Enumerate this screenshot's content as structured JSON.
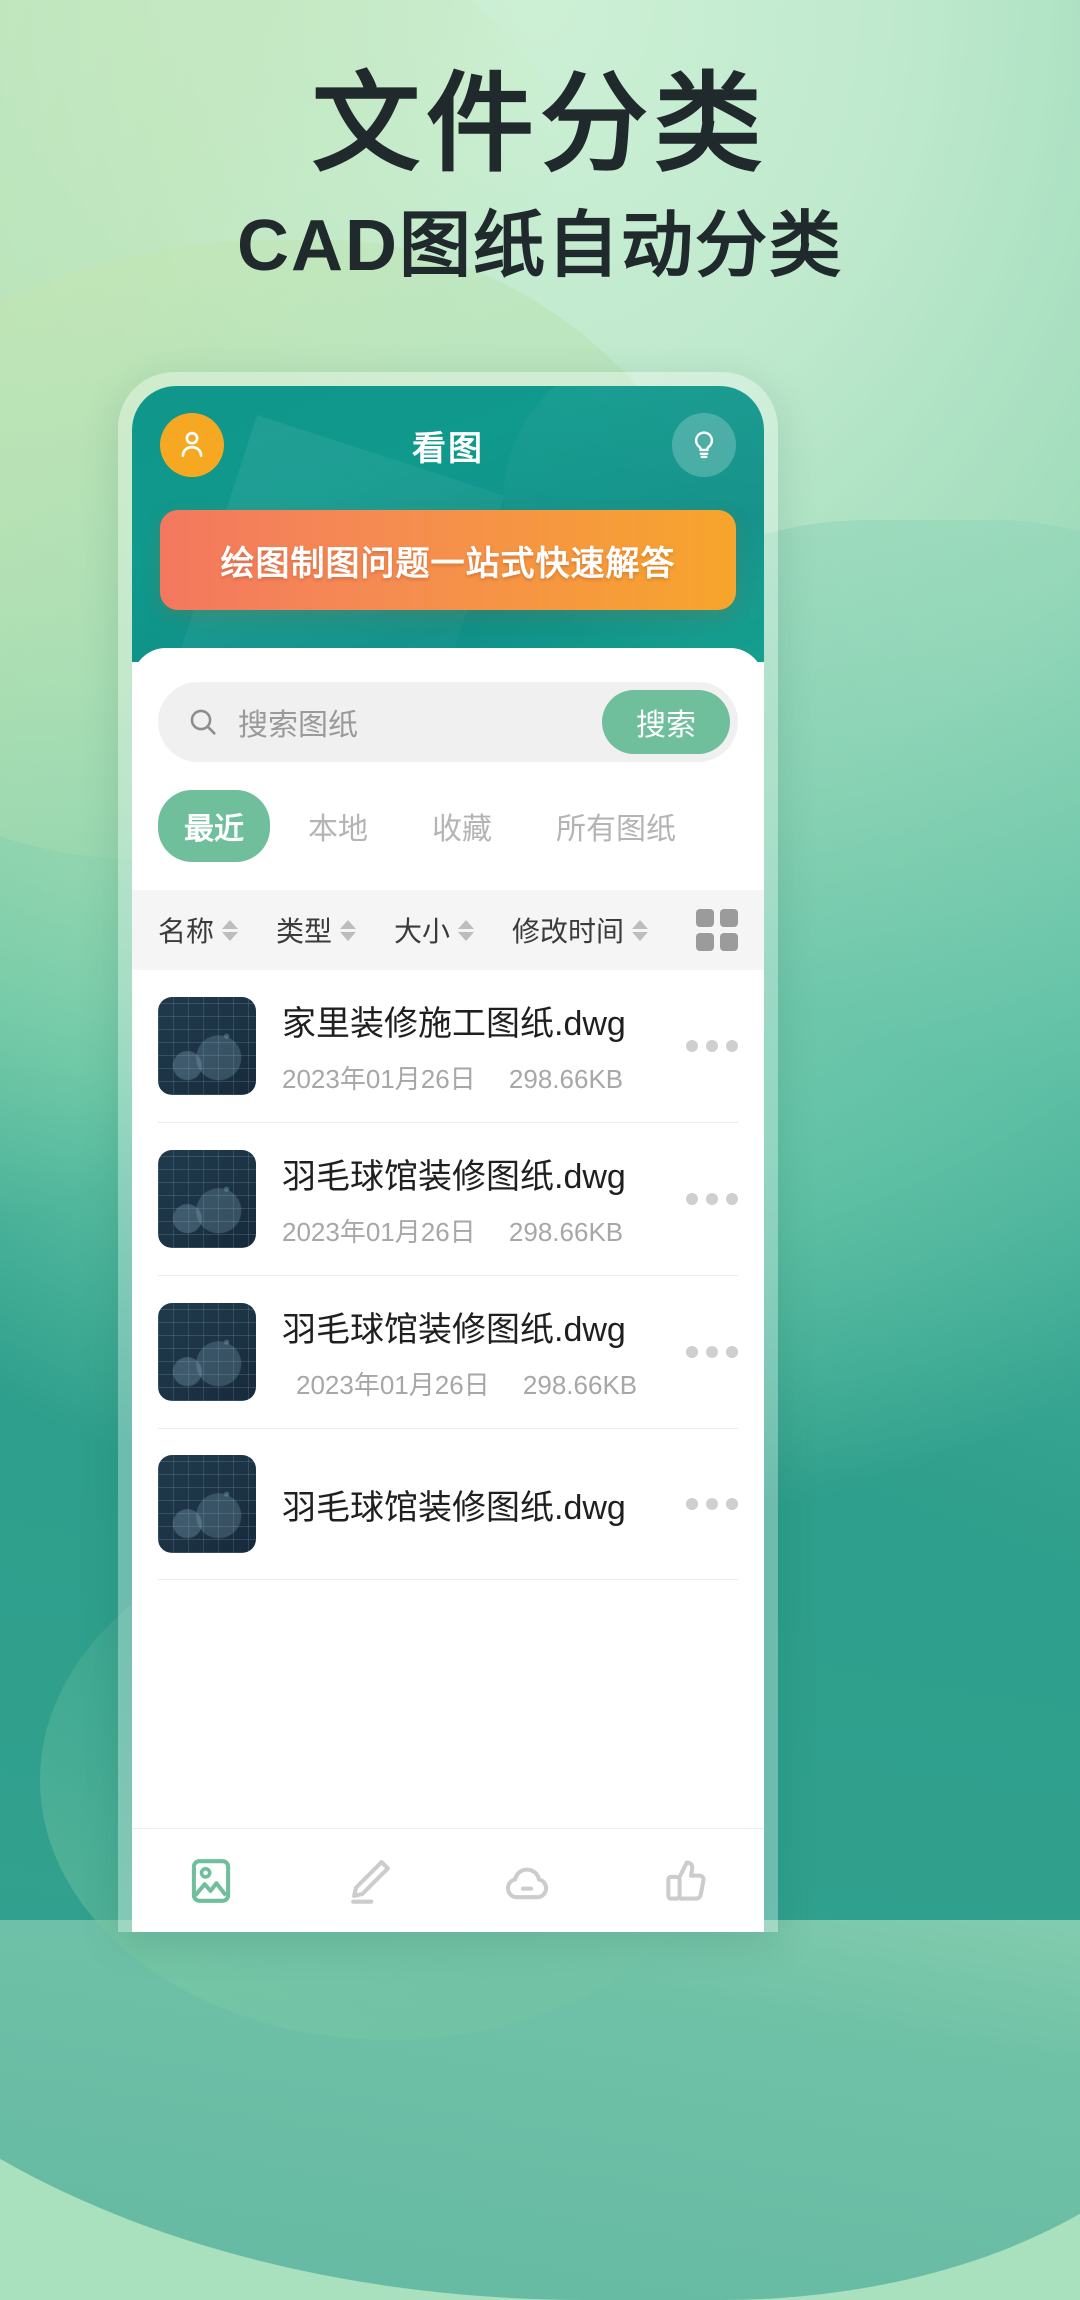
{
  "poster": {
    "headline": "文件分类",
    "subheadline": "CAD图纸自动分类"
  },
  "app": {
    "header": {
      "title": "看图",
      "avatar_icon": "user-avatar-icon",
      "bulb_icon": "lightbulb-icon",
      "promo_text": "绘图制图问题一站式快速解答"
    },
    "search": {
      "placeholder": "搜索图纸",
      "button_label": "搜索",
      "icon": "search-icon"
    },
    "tabs": [
      {
        "label": "最近",
        "active": true
      },
      {
        "label": "本地",
        "active": false
      },
      {
        "label": "收藏",
        "active": false
      },
      {
        "label": "所有图纸",
        "active": false
      }
    ],
    "columns": [
      {
        "label": "名称"
      },
      {
        "label": "类型"
      },
      {
        "label": "大小"
      },
      {
        "label": "修改时间"
      }
    ],
    "view_toggle_icon": "grid-view-icon",
    "files": [
      {
        "name": "家里装修施工图纸.dwg",
        "date": "2023年01月26日",
        "size": "298.66KB"
      },
      {
        "name": "羽毛球馆装修图纸.dwg",
        "date": "2023年01月26日",
        "size": "298.66KB"
      },
      {
        "name": "羽毛球馆装修图纸.dwg",
        "date": "2023年01月26日",
        "size": "298.66KB"
      },
      {
        "name": "羽毛球馆装修图纸.dwg",
        "date": "",
        "size": ""
      }
    ],
    "bottom_nav": [
      {
        "icon": "image-icon",
        "active": true
      },
      {
        "icon": "pencil-icon",
        "active": false
      },
      {
        "icon": "cloud-icon",
        "active": false
      },
      {
        "icon": "thumbs-up-icon",
        "active": false
      }
    ]
  },
  "colors": {
    "brand_green": "#6FBF9C",
    "header_teal": "#109A8D",
    "promo_orange_start": "#F4785F",
    "promo_orange_end": "#F7A52C",
    "avatar_orange": "#F7A823",
    "thumb_navy": "#203A4C",
    "headline_dark": "#20292B"
  }
}
